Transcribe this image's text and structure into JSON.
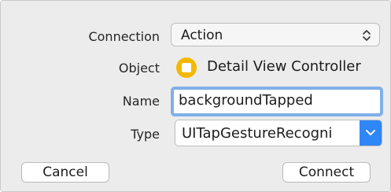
{
  "connection": {
    "label": "Connection",
    "value": "Action"
  },
  "object": {
    "label": "Object",
    "value": "Detail View Controller"
  },
  "name": {
    "label": "Name",
    "value": "backgroundTapped"
  },
  "type": {
    "label": "Type",
    "value": "UITapGestureRecogni"
  },
  "buttons": {
    "cancel": "Cancel",
    "connect": "Connect"
  },
  "colors": {
    "accent": "#2f86f6",
    "focus_ring": "#7fb0e8",
    "object_icon": "#f5b800"
  },
  "icons": {
    "connection_popup": "up-down-chevron-icon",
    "object": "view-controller-icon",
    "type_dropdown": "chevron-down-icon"
  }
}
